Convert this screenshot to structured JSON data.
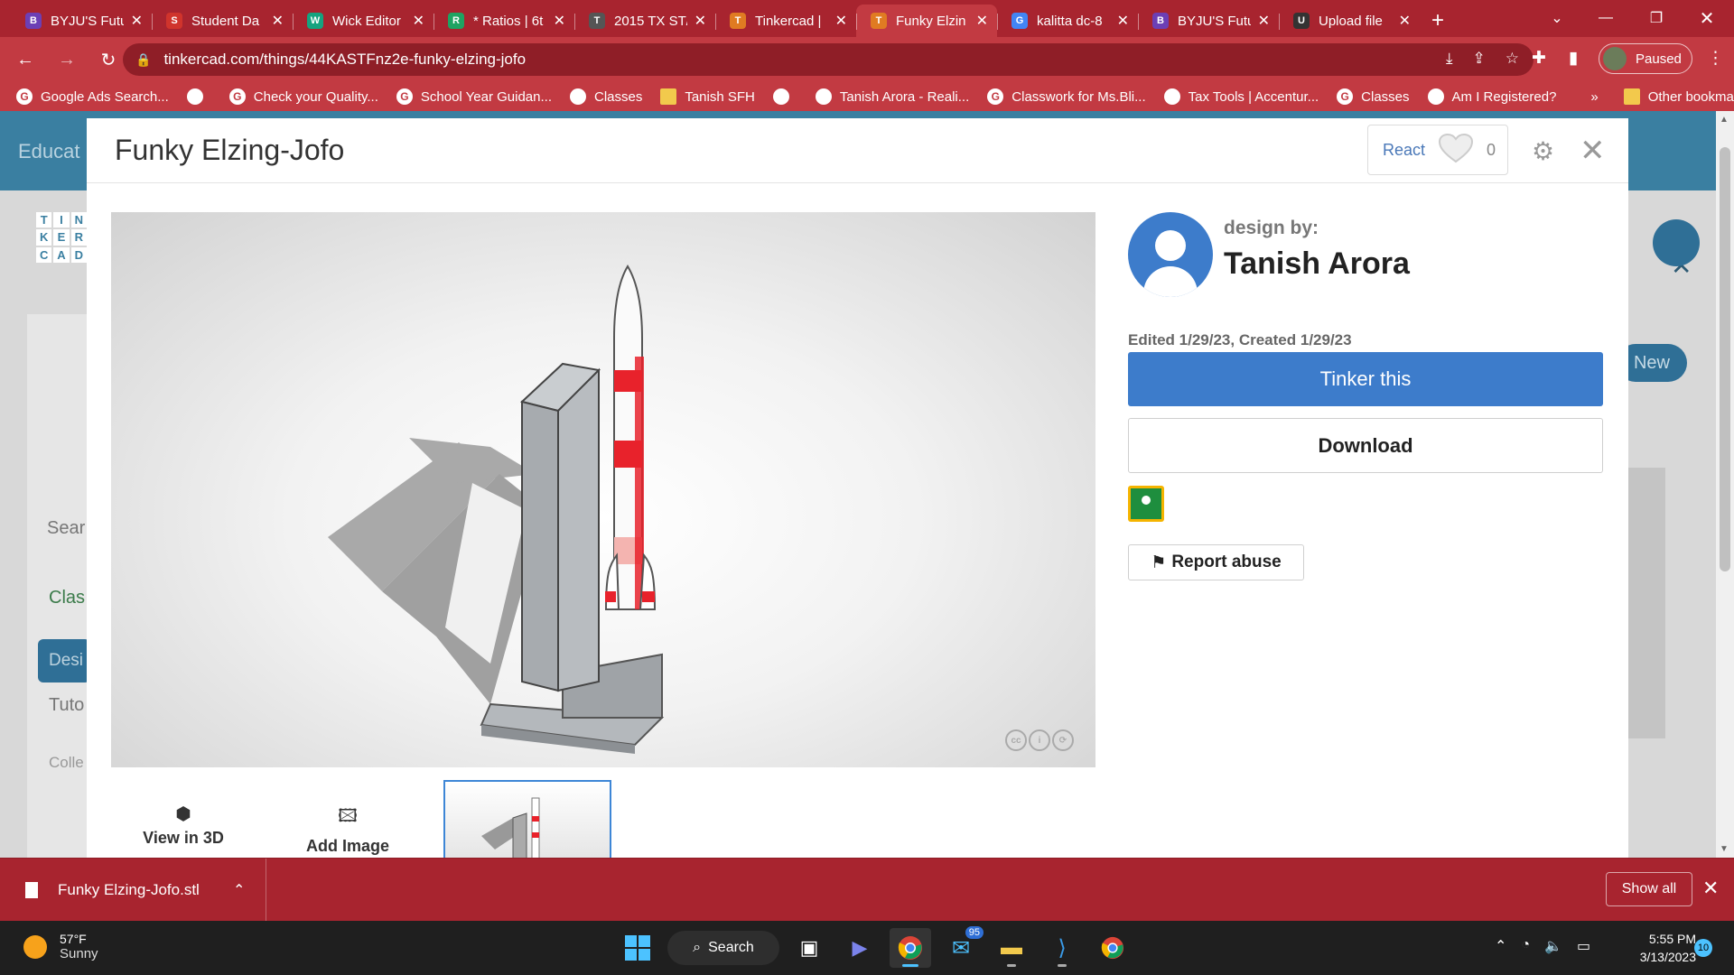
{
  "browser": {
    "tabs": [
      {
        "title": "BYJU'S Futu",
        "favicon_color": "#6c3fb5",
        "favicon": "B"
      },
      {
        "title": "Student Da",
        "favicon_color": "#d0342c",
        "favicon": "S"
      },
      {
        "title": "Wick Editor",
        "favicon_color": "#15a37f",
        "favicon": "W"
      },
      {
        "title": "* Ratios | 6t",
        "favicon_color": "#1ea362",
        "favicon": "R"
      },
      {
        "title": "2015 TX ST/",
        "favicon_color": "#555555",
        "favicon": "T"
      },
      {
        "title": "Tinkercad |",
        "favicon_color": "#e07b22",
        "favicon": "T"
      },
      {
        "title": "Funky Elzin",
        "favicon_color": "#e07b22",
        "favicon": "T"
      },
      {
        "title": "kalitta dc-8",
        "favicon_color": "#4285f4",
        "favicon": "G"
      },
      {
        "title": "BYJU'S Futu",
        "favicon_color": "#6c3fb5",
        "favicon": "B"
      },
      {
        "title": "Upload file",
        "favicon_color": "#333333",
        "favicon": "U"
      }
    ],
    "active_tab_index": 6,
    "url": "tinkercad.com/things/44KASTFnz2e-funky-elzing-jofo",
    "profile_label": "Paused",
    "bookmarks": [
      {
        "label": "Google Ads Search...",
        "icon": "google-icon"
      },
      {
        "label": "",
        "icon": "meet-icon"
      },
      {
        "label": "Check your Quality...",
        "icon": "google-icon"
      },
      {
        "label": "School Year Guidan...",
        "icon": "google-icon"
      },
      {
        "label": "Classes",
        "icon": "classroom-icon"
      },
      {
        "label": "Tanish SFH",
        "icon": "folder-icon"
      },
      {
        "label": "",
        "icon": "pinwheel-icon"
      },
      {
        "label": "Tanish Arora - Reali...",
        "icon": "drive-icon"
      },
      {
        "label": "Classwork for Ms.Bli...",
        "icon": "google-icon"
      },
      {
        "label": "Tax Tools | Accentur...",
        "icon": "windows-icon"
      },
      {
        "label": "Classes",
        "icon": "google-icon"
      },
      {
        "label": "Am I Registered?",
        "icon": "globe-icon"
      }
    ],
    "overflow": "»",
    "other_bookmarks": "Other bookmarks"
  },
  "background_page": {
    "edu_label": "Educat",
    "search_placeholder": "Sear",
    "class_label": "Clas",
    "design_label": "Desi",
    "tutorials_label": "Tuto",
    "collections_label": "Colle",
    "new_label": "New"
  },
  "modal": {
    "title": "Funky Elzing-Jofo",
    "react_label": "React",
    "react_count": "0",
    "design_by_label": "design by:",
    "designer_name": "Tanish Arora",
    "dates": "Edited 1/29/23, Created 1/29/23",
    "tinker_button": "Tinker this",
    "download_button": "Download",
    "report_button": "Report abuse",
    "view_3d_label": "View in 3D",
    "add_image_label": "Add Image"
  },
  "download_bar": {
    "filename": "Funky Elzing-Jofo.stl",
    "show_all": "Show all"
  },
  "taskbar": {
    "temperature": "57°F",
    "condition": "Sunny",
    "search_label": "Search",
    "mail_badge": "95",
    "time": "5:55 PM",
    "date": "3/13/2023",
    "notification_count": "10"
  },
  "colors": {
    "browser_accent": "#c23a42",
    "tinker_blue": "#3d7ccb",
    "rocket_red": "#e8222b"
  }
}
